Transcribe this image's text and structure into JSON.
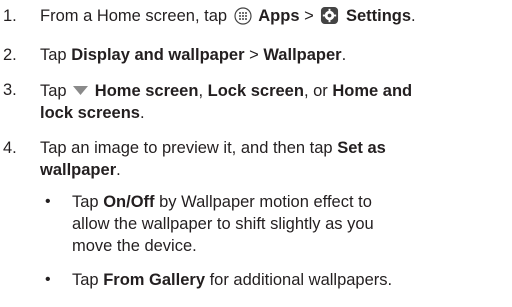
{
  "steps": [
    {
      "number": "1.",
      "pre": "From a Home screen, tap",
      "apps_icon": "apps-grid-icon",
      "apps_label": "Apps",
      "sep": ">",
      "settings_icon": "settings-gear-icon",
      "settings_label": "Settings",
      "end": "."
    },
    {
      "number": "2.",
      "pre": "Tap",
      "b1": "Display and wallpaper",
      "sep": ">",
      "b2": "Wallpaper",
      "end": "."
    },
    {
      "number": "3.",
      "pre": "Tap",
      "dropdown_icon": "dropdown-triangle-icon",
      "b1": "Home screen",
      "c1": ",",
      "b2": "Lock screen",
      "c2": ", or",
      "b3a": "Home and",
      "b3b": "lock screens",
      "end": "."
    },
    {
      "number": "4.",
      "pre": "Tap an image to preview it, and then tap",
      "b1a": "Set as",
      "b1b": "wallpaper",
      "end": "."
    }
  ],
  "bullets": [
    {
      "symbol": "•",
      "pre": "Tap",
      "b1": "On/Off",
      "line1_rest": "by Wallpaper motion effect to",
      "line2": "allow the wallpaper to shift slightly as you",
      "line3": "move the device."
    },
    {
      "symbol": "•",
      "pre": "Tap",
      "b1": "From Gallery",
      "rest": "for additional wallpapers."
    }
  ]
}
